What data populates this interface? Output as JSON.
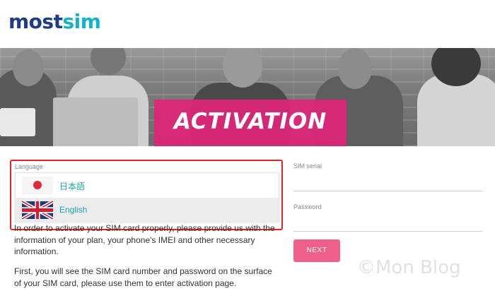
{
  "header": {
    "logo_part1": "most",
    "logo_part2": "sim"
  },
  "hero": {
    "banner_title": "ACTIVATION",
    "banner_color": "#e0257a"
  },
  "language_selector": {
    "label": "Language",
    "options": [
      {
        "label": "日本語",
        "icon": "japan-flag-icon"
      },
      {
        "label": "English",
        "icon": "uk-flag-icon",
        "highlighted": true
      }
    ],
    "border_color": "#e32424"
  },
  "instructions": {
    "paragraph1": "In order to activate your SIM card properly, please provide us with the information of your plan, your phone's IMEI and other necessary information.",
    "paragraph2": "First, you will see the SIM card number and password on the surface of your SIM card, please use them to enter activation page."
  },
  "form": {
    "sim_serial_label": "SIM serial",
    "password_label": "Password",
    "next_button": "NEXT",
    "button_color": "#ef5f8c"
  },
  "watermark": "©Mon Blog"
}
